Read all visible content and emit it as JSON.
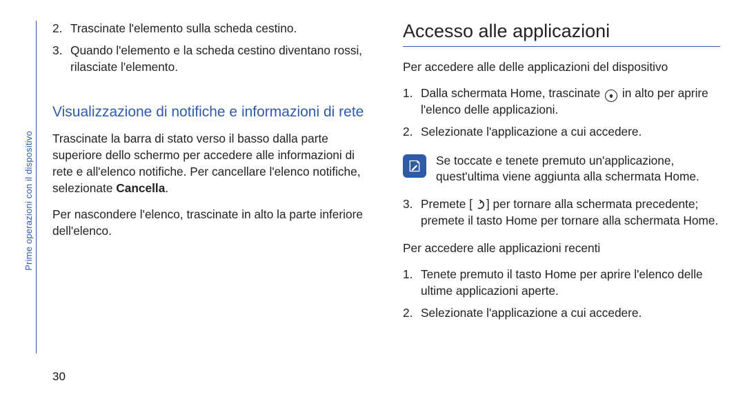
{
  "sidebar": {
    "label": "Prime operazioni con il dispositivo"
  },
  "page_number": "30",
  "left": {
    "items": [
      {
        "num": "2.",
        "text": "Trascinate l'elemento sulla scheda cestino."
      },
      {
        "num": "3.",
        "text": "Quando l'elemento e la scheda cestino diventano rossi, rilasciate l'elemento."
      }
    ],
    "subhead": "Visualizzazione di notifiche e informazioni di rete",
    "para1_a": "Trascinate la barra di stato verso il basso dalla parte superiore dello schermo per accedere alle informazioni di rete e all'elenco notifiche. Per cancellare l'elenco notifiche, selezionate ",
    "para1_bold": "Cancella",
    "para1_b": ".",
    "para2": "Per nascondere l'elenco, trascinate in alto la parte inferiore dell'elenco."
  },
  "right": {
    "heading": "Accesso alle applicazioni",
    "intro": "Per accedere alle delle applicazioni del dispositivo",
    "step1_a": "Dalla schermata Home, trascinate ",
    "step1_b": " in alto per aprire l'elenco delle applicazioni.",
    "step2": "Selezionate l'applicazione a cui accedere.",
    "note": "Se toccate e tenete premuto un'applicazione, quest'ultima viene aggiunta alla schermata Home.",
    "step3_a": "Premete [",
    "step3_b": "] per tornare alla schermata precedente; premete il tasto Home per tornare alla schermata Home.",
    "recent_intro": "Per accedere alle applicazioni recenti",
    "recent1": "Tenete premuto il tasto Home per aprire l'elenco delle ultime applicazioni aperte.",
    "recent2": "Selezionate l'applicazione a cui accedere.",
    "nums": {
      "n1": "1.",
      "n2": "2.",
      "n3": "3."
    }
  }
}
